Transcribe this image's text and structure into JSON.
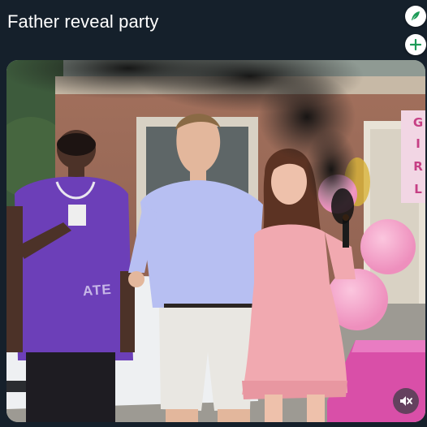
{
  "post": {
    "title": "Father reveal party"
  },
  "actions": {
    "compose_icon": "feather-icon",
    "add_icon": "plus-icon",
    "accent_color": "#1d9b57"
  },
  "media": {
    "jersey_text": "ATE",
    "sign_letters": [
      "G",
      "I",
      "R",
      "L"
    ],
    "mute_icon": "speaker-muted-icon",
    "smoke_color": "#1a1a1a",
    "balloon_color": "#f4a3c7"
  }
}
